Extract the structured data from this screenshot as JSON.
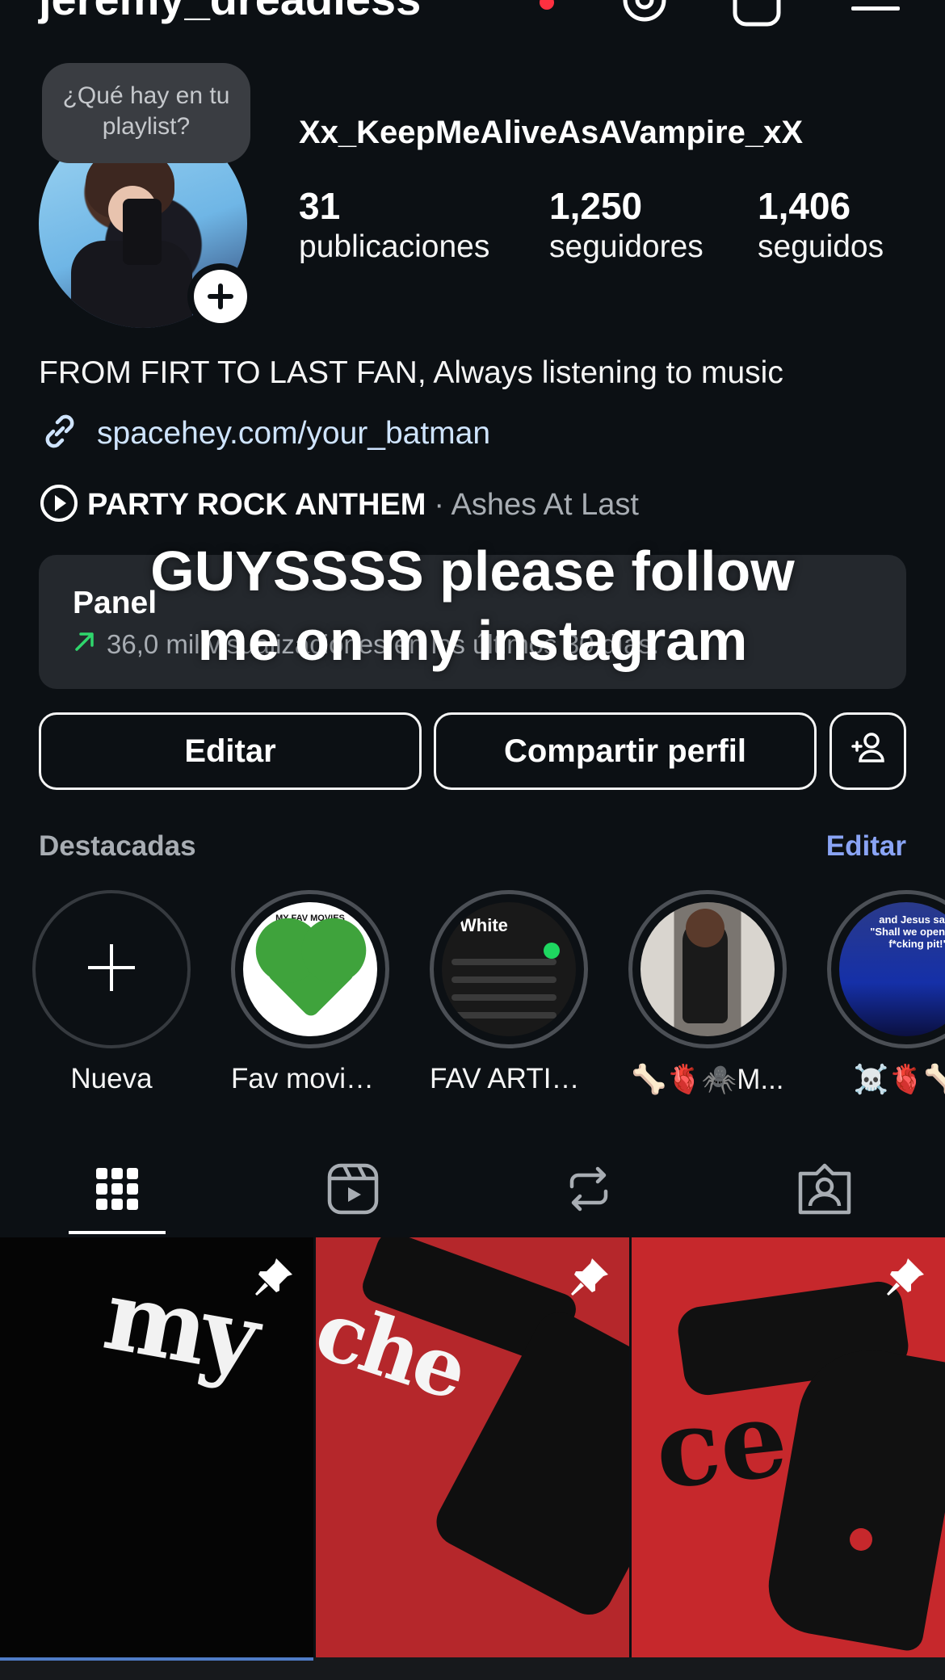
{
  "header": {
    "username": "jeremy_dreadless"
  },
  "note": {
    "text": "¿Qué hay en tu playlist?"
  },
  "profile": {
    "display_name": "Xx_KeepMeAliveAsAVampire_xX",
    "stats": [
      {
        "value": "31",
        "label": "publicaciones"
      },
      {
        "value": "1,250",
        "label": "seguidores"
      },
      {
        "value": "1,406",
        "label": "seguidos"
      }
    ],
    "bio": "FROM FIRT TO LAST FAN, Always listening to music",
    "link": "spacehey.com/your_batman",
    "music": {
      "song": "PARTY ROCK ANTHEM",
      "artist": "· Ashes At Last"
    }
  },
  "panel": {
    "title": "Panel",
    "subtitle": "36,0 mil visualizaciones en los últimos 30 días."
  },
  "overlay": {
    "line1": "GUYSSSS please follow",
    "line2": "me on my instagram"
  },
  "buttons": {
    "edit": "Editar",
    "share": "Compartir perfil"
  },
  "highlights": {
    "title": "Destacadas",
    "edit": "Editar",
    "items": [
      {
        "label": "Nueva"
      },
      {
        "label": "Fav movies!!!!",
        "thumb_text": "MY FAV MOVIES"
      },
      {
        "label": "FAV ARTIST...",
        "thumb_text": "White"
      },
      {
        "label": "🦴🫀🕷️M..."
      },
      {
        "label": "☠️🫀🦴",
        "thumb_text": "and Jesus said: \"Shall we open this f*cking pit!\""
      }
    ]
  },
  "tabs": [
    "grid-icon",
    "reels-icon",
    "reposts-icon",
    "tagged-icon"
  ],
  "colors": {
    "background": "#0c1014",
    "panel": "#24282d",
    "accent_link": "#8aa4f5",
    "trend_green": "#2fd66c"
  }
}
